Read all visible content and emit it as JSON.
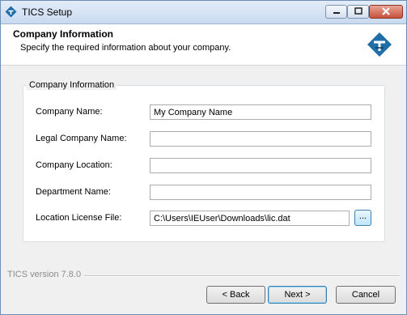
{
  "window": {
    "title": "TICS Setup"
  },
  "header": {
    "title": "Company Information",
    "subtitle": "Specify the required information about your company."
  },
  "group": {
    "label": "Company Information"
  },
  "fields": [
    {
      "label": "Company Name:",
      "value": "My Company Name"
    },
    {
      "label": "Legal Company Name:",
      "value": ""
    },
    {
      "label": "Company Location:",
      "value": ""
    },
    {
      "label": "Department Name:",
      "value": ""
    },
    {
      "label": "Location License File:",
      "value": "C:\\Users\\IEUser\\Downloads\\lic.dat"
    }
  ],
  "browse_label": "...",
  "version": "TICS version 7.8.0",
  "buttons": {
    "back": "< Back",
    "next": "Next >",
    "cancel": "Cancel"
  },
  "colors": {
    "title_bar": "#c9daf0",
    "close_button": "#c7513c",
    "focus_accent": "#3c7fb1"
  }
}
